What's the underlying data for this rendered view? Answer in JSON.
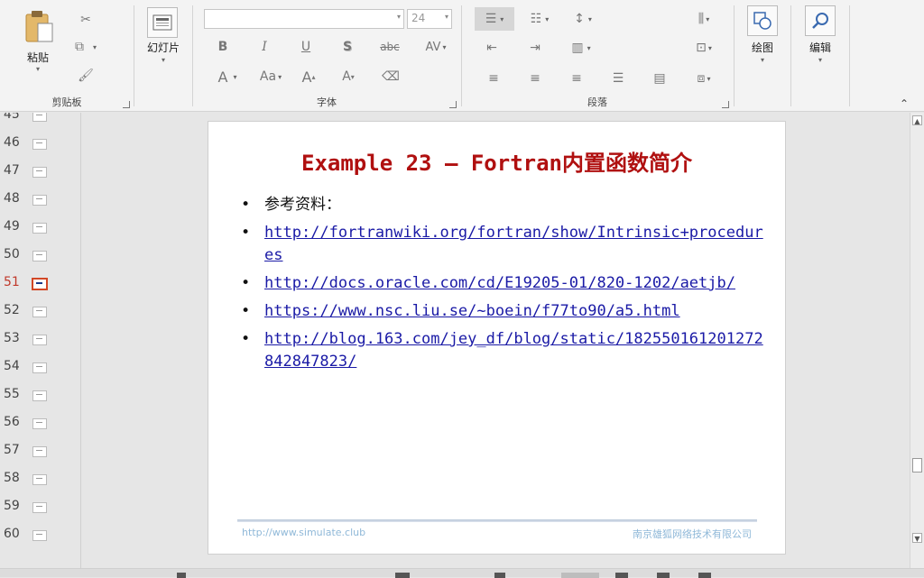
{
  "ribbon": {
    "clipboard": {
      "paste_label": "粘贴",
      "group_label": "剪贴板"
    },
    "slides": {
      "label": "幻灯片"
    },
    "font": {
      "family_value": "",
      "size_value": "24",
      "group_label": "字体",
      "bold": "B",
      "italic": "I",
      "underline": "U",
      "shadow": "S",
      "strike": "abc",
      "spacing": "AV",
      "color": "A",
      "case": "Aa",
      "grow": "A",
      "shrink": "A"
    },
    "paragraph": {
      "group_label": "段落"
    },
    "drawing": {
      "label": "绘图"
    },
    "editing": {
      "label": "编辑"
    }
  },
  "thumbnails": [
    {
      "num": "45",
      "active": false
    },
    {
      "num": "46",
      "active": false
    },
    {
      "num": "47",
      "active": false
    },
    {
      "num": "48",
      "active": false
    },
    {
      "num": "49",
      "active": false
    },
    {
      "num": "50",
      "active": false
    },
    {
      "num": "51",
      "active": true
    },
    {
      "num": "52",
      "active": false
    },
    {
      "num": "53",
      "active": false
    },
    {
      "num": "54",
      "active": false
    },
    {
      "num": "55",
      "active": false
    },
    {
      "num": "56",
      "active": false
    },
    {
      "num": "57",
      "active": false
    },
    {
      "num": "58",
      "active": false
    },
    {
      "num": "59",
      "active": false
    },
    {
      "num": "60",
      "active": false
    }
  ],
  "slide": {
    "title": "Example 23  –  Fortran内置函数简介",
    "bullets": [
      {
        "text": "参考资料：",
        "link": false
      },
      {
        "text": "http://fortranwiki.org/fortran/show/Intrinsic+procedures",
        "link": true
      },
      {
        "text": "http://docs.oracle.com/cd/E19205-01/820-1202/aetjb/",
        "link": true
      },
      {
        "text": "https://www.nsc.liu.se/~boein/f77to90/a5.html",
        "link": true
      },
      {
        "text": "http://blog.163.com/jey_df/blog/static/182550161201272842847823/",
        "link": true
      }
    ],
    "footer_left": "http://www.simulate.club",
    "footer_right": "南京雄狐网络技术有限公司"
  },
  "colors": {
    "title": "#b01010",
    "link": "#1a1aa6",
    "active_thumb": "#d24726",
    "footer_text": "#8fb8d8"
  }
}
